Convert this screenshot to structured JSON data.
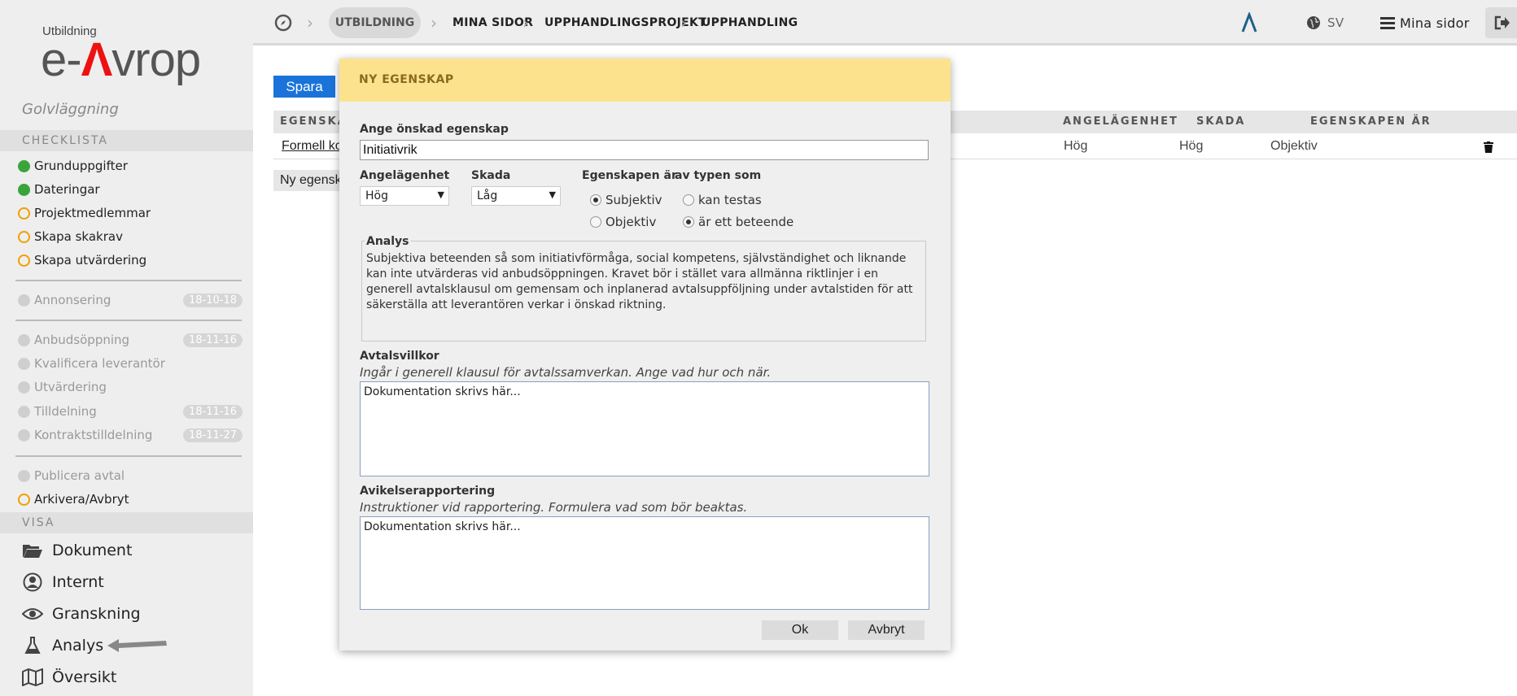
{
  "logo": {
    "small": "Utbildning",
    "big_before": "e-",
    "big_mark": "Λ",
    "big_after": "vrop"
  },
  "sidebar": {
    "project": "Golvläggning",
    "checklist_title": "CHECKLISTA",
    "checklist": [
      {
        "label": "Grunduppgifter",
        "status": "done"
      },
      {
        "label": "Dateringar",
        "status": "done"
      },
      {
        "label": "Projektmedlemmar",
        "status": "open"
      },
      {
        "label": "Skapa skakrav",
        "status": "open"
      },
      {
        "label": "Skapa utvärdering",
        "status": "open"
      }
    ],
    "stage1": [
      {
        "label": "Annonsering",
        "date": "18-10-18"
      }
    ],
    "stage2": [
      {
        "label": "Anbudsöppning",
        "date": "18-11-16"
      },
      {
        "label": "Kvalificera leverantör",
        "date": ""
      },
      {
        "label": "Utvärdering",
        "date": ""
      },
      {
        "label": "Tilldelning",
        "date": "18-11-16"
      },
      {
        "label": "Kontraktstilldelning",
        "date": "18-11-27"
      }
    ],
    "stage3": [
      {
        "label": "Publicera avtal",
        "status": "grey"
      },
      {
        "label": "Arkivera/Avbryt",
        "status": "open"
      }
    ],
    "view_title": "VISA",
    "view": [
      {
        "label": "Dokument",
        "icon": "folder-icon"
      },
      {
        "label": "Internt",
        "icon": "user-icon"
      },
      {
        "label": "Granskning",
        "icon": "eye-icon"
      },
      {
        "label": "Analys",
        "icon": "flask-icon"
      },
      {
        "label": "Översikt",
        "icon": "map-icon"
      }
    ]
  },
  "topbar": {
    "breadcrumb": [
      "UTBILDNING",
      "MINA SIDOR",
      "UPPHANDLINGSPROJEKT",
      "UPPHANDLING"
    ],
    "language": "SV",
    "menu": "Mina sidor"
  },
  "main": {
    "save": "Spara",
    "columns": [
      "EGENSKA",
      "ANGELÄGENHET",
      "SKADA",
      "EGENSKAPEN ÄR"
    ],
    "row": {
      "name": "Formell ko",
      "importance": "Hög",
      "damage": "Hög",
      "type": "Objektiv"
    },
    "new_property": "Ny egenskap"
  },
  "dialog": {
    "title": "NY EGENSKAP",
    "prop_label": "Ange önskad egenskap",
    "prop_value": "Initiativrik",
    "importance_label": "Angelägenhet",
    "importance_value": "Hög",
    "damage_label": "Skada",
    "damage_value": "Låg",
    "is_label": "Egenskapen är",
    "kind_label": "av typen som",
    "radio_subj": "Subjektiv",
    "radio_obj": "Objektiv",
    "radio_testable": "kan testas",
    "radio_behavior": "är ett beteende",
    "analysis_label": "Analys",
    "analysis_text": "Subjektiva beteenden så som initiativförmåga, social kompetens, självständighet och liknande kan inte utvärderas vid anbudsöppningen. Kravet bör i stället vara allmänna riktlinjer i en generell avtalsklausul om gemensam och inplanerad avtalsuppföljning under avtalstiden för att säkerställa att leverantören verkar i önskad riktning.",
    "terms_label": "Avtalsvillkor",
    "terms_hint": "Ingår i generell klausul för avtalssamverkan. Ange vad hur och när.",
    "terms_placeholder": "Dokumentation skrivs här...",
    "deviation_label": "Avikelserapportering",
    "deviation_hint": "Instruktioner vid rapportering. Formulera vad som bör beaktas.",
    "deviation_placeholder": "Dokumentation skrivs här...",
    "ok": "Ok",
    "cancel": "Avbryt"
  }
}
